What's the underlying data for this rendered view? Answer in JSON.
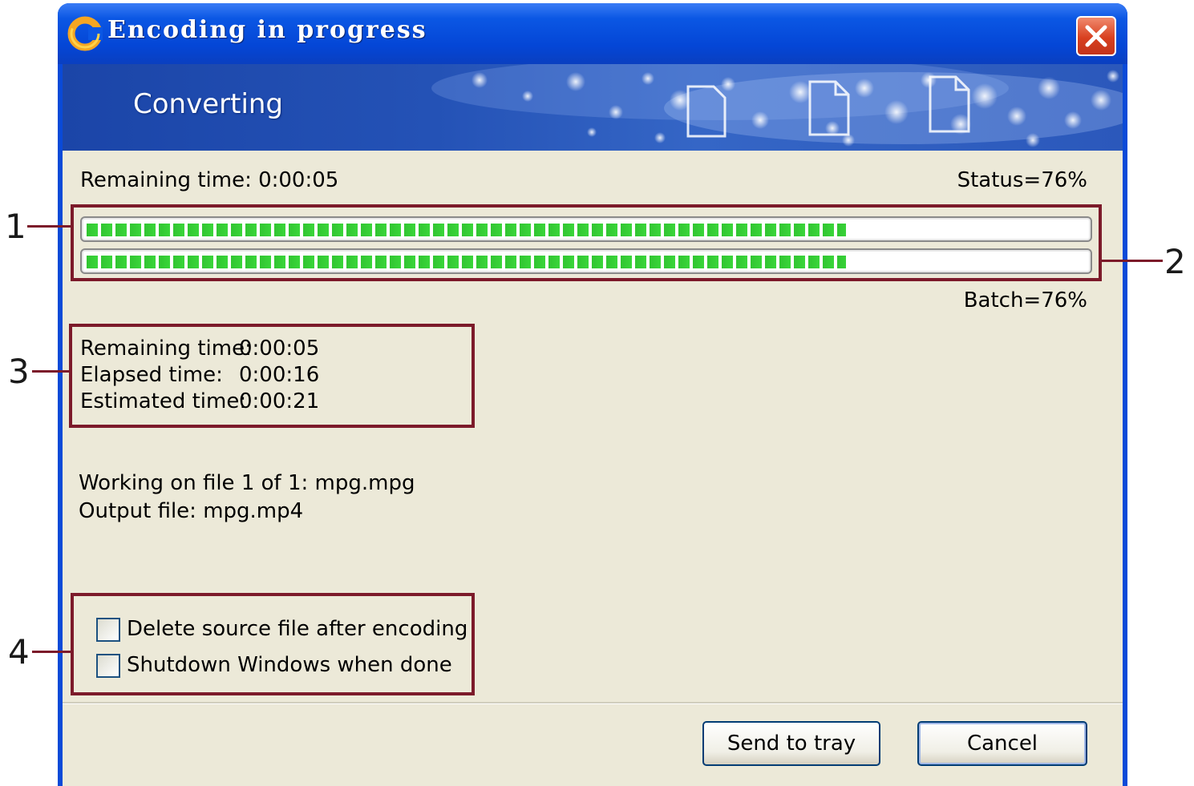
{
  "window": {
    "title": "Encoding in progress",
    "banner_title": "Converting"
  },
  "progress": {
    "remaining_label": "Remaining time: 0:00:05",
    "status_label": "Status=76%",
    "batch_label": "Batch=76%",
    "file_progress_fraction": 0.76,
    "batch_progress_fraction": 0.76
  },
  "times": {
    "remaining_key": "Remaining time:",
    "remaining_value": "0:00:05",
    "elapsed_key": "Elapsed time:",
    "elapsed_value": "0:00:16",
    "estimated_key": "Estimated time:",
    "estimated_value": "0:00:21"
  },
  "files": {
    "working_on": "Working on file 1 of 1: mpg.mpg",
    "output": "Output file: mpg.mp4"
  },
  "options": {
    "delete_source_label": "Delete source file after encoding",
    "delete_source_checked": false,
    "shutdown_label": "Shutdown Windows when done",
    "shutdown_checked": false
  },
  "buttons": {
    "send_to_tray": "Send to tray",
    "cancel": "Cancel"
  },
  "annotations": {
    "n1": "1",
    "n2": "2",
    "n3": "3",
    "n4": "4"
  },
  "colors": {
    "titlebar": "#0446d6",
    "progress_green": "#31c531",
    "annotation_red": "#7c1a2a",
    "dialog_bg": "#ece9d8"
  }
}
